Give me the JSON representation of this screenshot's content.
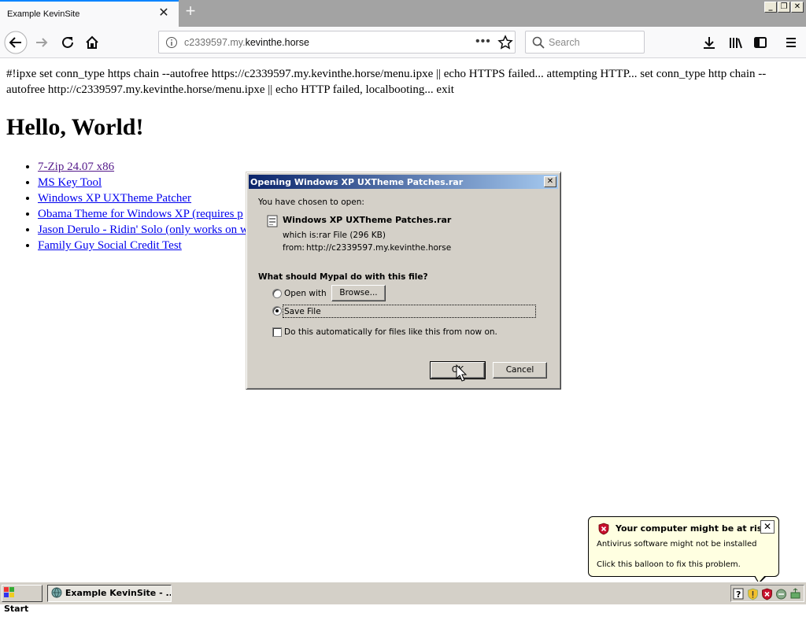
{
  "browser": {
    "tab_title": "Example KevinSite",
    "tab_close": "✕",
    "new_tab": "+",
    "url_prefix": "c2339597.my.",
    "url_domain": "kevinthe.horse",
    "url_more": "•••",
    "search_placeholder": "Search"
  },
  "window_controls": {
    "minimize": "_",
    "restore": "❐",
    "close": "✕"
  },
  "page": {
    "ipxe_text": "#!ipxe set conn_type https chain --autofree https://c2339597.my.kevinthe.horse/menu.ipxe || echo HTTPS failed... attempting HTTP... set conn_type http chain --autofree http://c2339597.my.kevinthe.horse/menu.ipxe || echo HTTP failed, localbooting... exit",
    "heading": "Hello, World!",
    "links": [
      {
        "label": "7-Zip 24.07 x86"
      },
      {
        "label": "MS Key Tool"
      },
      {
        "label": "Windows XP UXTheme Patcher"
      },
      {
        "label": "Obama Theme for Windows XP (requires p"
      },
      {
        "label": "Jason Derulo - Ridin' Solo (only works on w"
      },
      {
        "label": "Family Guy Social Credit Test"
      }
    ]
  },
  "dialog": {
    "title": "Opening Windows XP UXTheme Patches.rar",
    "close": "✕",
    "chosen_label": "You have chosen to open:",
    "file_name": "Windows XP UXTheme Patches.rar",
    "which_is_label": "which is:",
    "which_is_value": "rar File (296 KB)",
    "from_label": "from:",
    "from_value": "http://c2339597.my.kevinthe.horse",
    "question": "What should Mypal do with this file?",
    "open_with_label": "Open with",
    "browse_label": "Browse...",
    "save_file_label": "Save File",
    "auto_label": "Do this automatically for files like this from now on.",
    "ok_label": "OK",
    "cancel_label": "Cancel",
    "selected_option": "Save File"
  },
  "balloon": {
    "title": "Your computer might be at risk",
    "line1": "Antivirus software might not be installed",
    "line2": "Click this balloon to fix this problem.",
    "close": "✕"
  },
  "taskbar": {
    "start_label": "Start",
    "task_label": "Example KevinSite - ..."
  },
  "colors": {
    "accent": "#0a84ff",
    "titlebar_start": "#0a246a",
    "titlebar_end": "#a6caf0",
    "link": "#0000ee",
    "visited": "#551a8b"
  }
}
